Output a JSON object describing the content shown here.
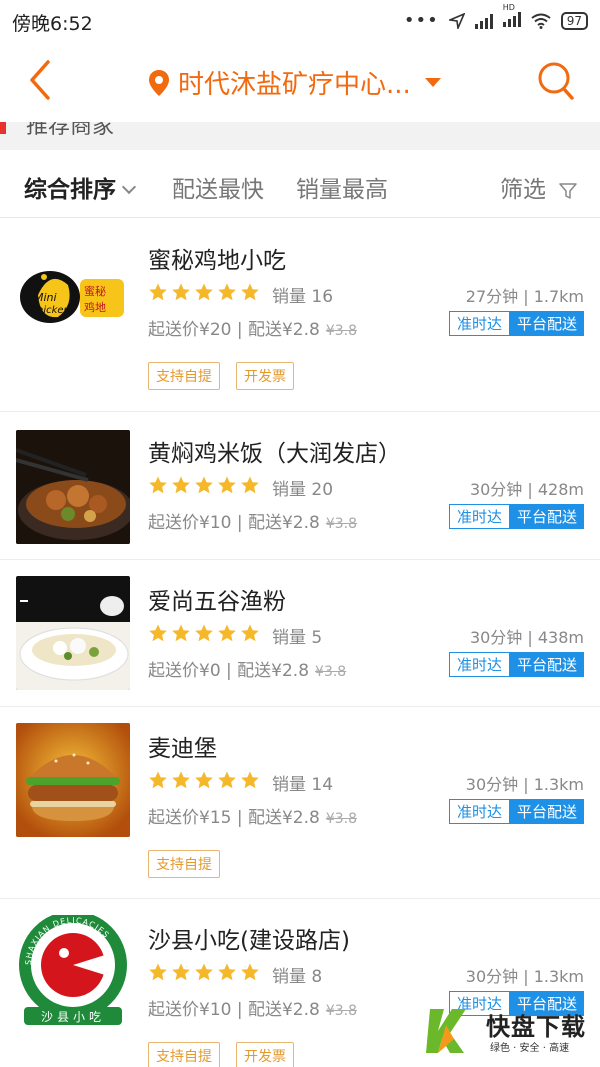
{
  "status_bar": {
    "time": "傍晚6:52",
    "battery": "97",
    "hd_label": "HD"
  },
  "header": {
    "location": "时代沐盐矿疗中心...",
    "accent_color": "#f26a0f"
  },
  "section": {
    "title": "推荐商家"
  },
  "sort_bar": {
    "items": [
      {
        "label": "综合排序",
        "active": true
      },
      {
        "label": "配送最快"
      },
      {
        "label": "销量最高"
      },
      {
        "label": "筛选"
      }
    ]
  },
  "stores": [
    {
      "name": "蜜秘鸡地小吃",
      "rating_stars": 5,
      "sales": "销量 16",
      "time_dist": "27分钟 | 1.7km",
      "fees": "起送价¥20 | 配送¥2.8",
      "old_fee": "¥3.8",
      "badge_ontime": "准时达",
      "badge_platform": "平台配送",
      "tags": [
        "支持自提",
        "开发票"
      ],
      "logo_text_1": "Mini",
      "logo_text_2": "Chicken",
      "logo_text_3": "蜜秘",
      "logo_text_4": "鸡地"
    },
    {
      "name": "黄焖鸡米饭（大润发店）",
      "rating_stars": 5,
      "sales": "销量 20",
      "time_dist": "30分钟 | 428m",
      "fees": "起送价¥10 | 配送¥2.8",
      "old_fee": "¥3.8",
      "badge_ontime": "准时达",
      "badge_platform": "平台配送",
      "tags": []
    },
    {
      "name": "爱尚五谷渔粉",
      "rating_stars": 5,
      "sales": "销量 5",
      "time_dist": "30分钟 | 438m",
      "fees": "起送价¥0 | 配送¥2.8",
      "old_fee": "¥3.8",
      "badge_ontime": "准时达",
      "badge_platform": "平台配送",
      "tags": []
    },
    {
      "name": "麦迪堡",
      "rating_stars": 5,
      "sales": "销量 14",
      "time_dist": "30分钟 | 1.3km",
      "fees": "起送价¥15 | 配送¥2.8",
      "old_fee": "¥3.8",
      "badge_ontime": "准时达",
      "badge_platform": "平台配送",
      "tags": [
        "支持自提"
      ]
    },
    {
      "name": "沙县小吃(建设路店)",
      "rating_stars": 5,
      "sales": "销量 8",
      "time_dist": "30分钟 | 1.3km",
      "fees": "起送价¥10 | 配送¥2.8",
      "old_fee": "¥3.8",
      "badge_ontime": "准时达",
      "badge_platform": "平台配送",
      "tags": [
        "支持自提",
        "开发票"
      ],
      "logo_ring_text": "SHAXIAN DELICACIES",
      "logo_cn_text": "沙县小吃"
    }
  ],
  "watermark": {
    "title": "快盘下载",
    "subtitle": "绿色 · 安全 · 高速"
  }
}
